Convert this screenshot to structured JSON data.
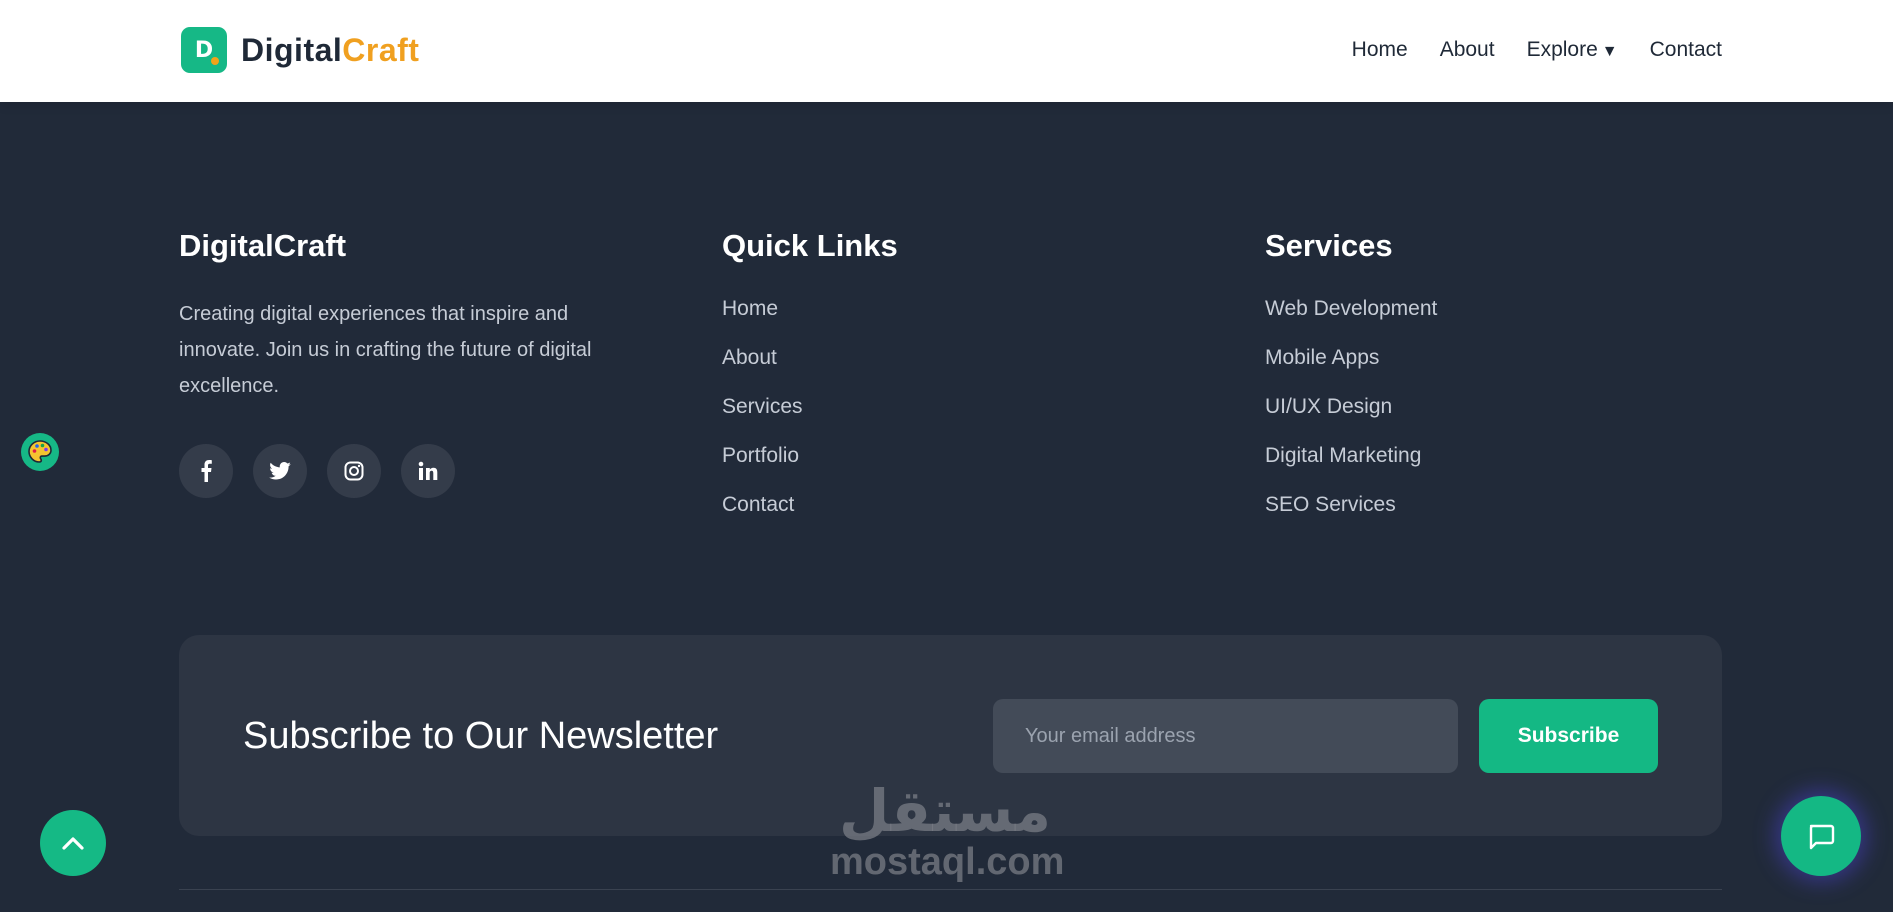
{
  "header": {
    "logo_badge_letter": "D",
    "logo_part1": "Digital",
    "logo_part2": "Craft",
    "nav": [
      {
        "label": "Home"
      },
      {
        "label": "About"
      },
      {
        "label": "Explore"
      },
      {
        "label": "Contact"
      }
    ],
    "explore_caret": "▼"
  },
  "footer": {
    "brand": {
      "title": "DigitalCraft",
      "description": "Creating digital experiences that inspire and innovate. Join us in crafting the future of digital excellence.",
      "socials": [
        "facebook-icon",
        "twitter-icon",
        "instagram-icon",
        "linkedin-icon"
      ]
    },
    "quick_links": {
      "title": "Quick Links",
      "items": [
        "Home",
        "About",
        "Services",
        "Portfolio",
        "Contact"
      ]
    },
    "services": {
      "title": "Services",
      "items": [
        "Web Development",
        "Mobile Apps",
        "UI/UX Design",
        "Digital Marketing",
        "SEO Services"
      ]
    }
  },
  "newsletter": {
    "title": "Subscribe to Our Newsletter",
    "email_placeholder": "Your email address",
    "button_label": "Subscribe"
  },
  "watermark": {
    "arabic": "مستقل",
    "latin": "mostaql.com"
  },
  "colors": {
    "accent": "#16b886",
    "brand_orange": "#f0a020",
    "footer_bg": "#212a39",
    "newsletter_bg": "#2d3543"
  }
}
